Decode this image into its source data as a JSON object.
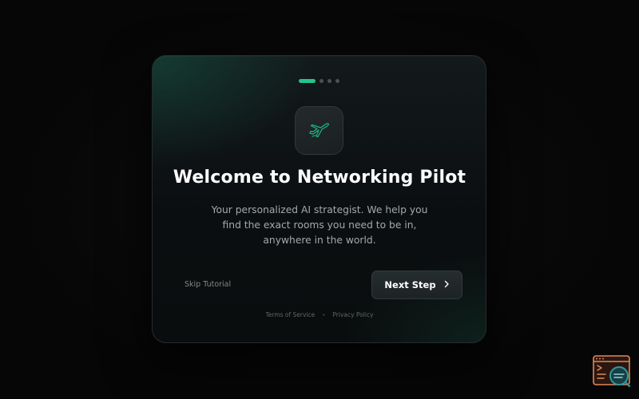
{
  "onboarding": {
    "steps_total": 4,
    "current_step": 1,
    "title": "Welcome to Networking Pilot",
    "subtitle": "Your personalized AI strategist. We help you find the exact rooms you need to be in, anywhere in the world.",
    "skip_label": "Skip Tutorial",
    "next_label": "Next Step",
    "logo_icon": "airplane-icon"
  },
  "footer": {
    "terms_label": "Terms of Service",
    "privacy_label": "Privacy Policy",
    "separator": "•"
  },
  "colors": {
    "accent": "#22c58b",
    "background": "#060606",
    "card": "#0f1416",
    "widget_orange": "#e0875a",
    "widget_teal": "#2f9aa0"
  },
  "corner_widget": {
    "icon": "terminal-search-icon"
  }
}
